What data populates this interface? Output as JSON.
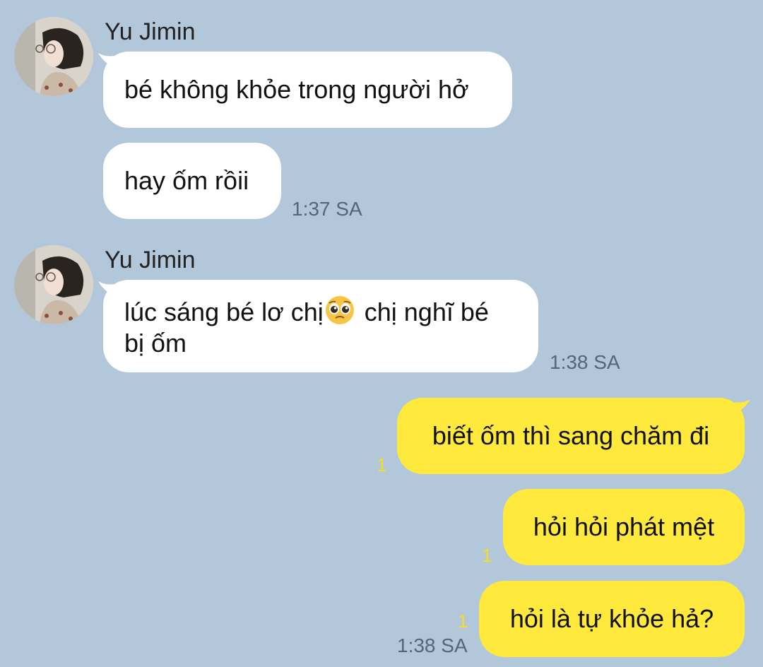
{
  "contact": {
    "name": "Yu Jimin",
    "avatar_icon": "profile-photo-icon"
  },
  "messages": [
    {
      "id": "m1",
      "direction": "incoming",
      "text": "bé không khỏe trong người hở"
    },
    {
      "id": "m2",
      "direction": "incoming",
      "text": "hay ốm rồii",
      "time": "1:37 SA"
    },
    {
      "id": "m3",
      "direction": "incoming",
      "text_before_emoji": "lúc sáng bé lơ chị",
      "emoji": "pleading-face",
      "text_after_emoji": " chị nghĩ bé",
      "text_line2": "bị ốm",
      "time": "1:38 SA"
    },
    {
      "id": "m4",
      "direction": "outgoing",
      "text": "biết ốm thì sang chăm đi",
      "unread": "1"
    },
    {
      "id": "m5",
      "direction": "outgoing",
      "text": "hỏi hỏi phát mệt",
      "unread": "1"
    },
    {
      "id": "m6",
      "direction": "outgoing",
      "text": "hỏi là tự khỏe hả?",
      "unread": "1",
      "time": "1:38 SA"
    }
  ],
  "colors": {
    "background": "#b2c7da",
    "incoming_bubble": "#ffffff",
    "outgoing_bubble": "#fee93c",
    "unread_count": "#f5dd1f"
  }
}
